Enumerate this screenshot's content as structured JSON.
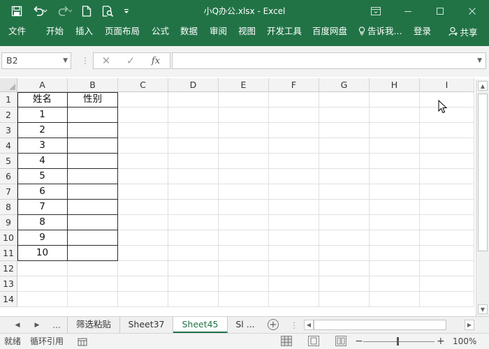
{
  "window": {
    "title": "小Q办公.xlsx  -  Excel"
  },
  "ribbon": {
    "tabs": [
      "文件",
      "开始",
      "插入",
      "页面布局",
      "公式",
      "数据",
      "审阅",
      "视图",
      "开发工具",
      "百度网盘",
      "告诉我...",
      "登录"
    ],
    "share_label": "共享"
  },
  "formula_bar": {
    "name_box": "B2",
    "fx_label": "fx",
    "content": ""
  },
  "sheet": {
    "columns": [
      "A",
      "B",
      "C",
      "D",
      "E",
      "F",
      "G",
      "H",
      "I"
    ],
    "rows": [
      "1",
      "2",
      "3",
      "4",
      "5",
      "6",
      "7",
      "8",
      "9",
      "10",
      "11",
      "12",
      "13",
      "14"
    ],
    "cells": {
      "A1": "姓名",
      "B1": "性别",
      "A2": "1",
      "A3": "2",
      "A4": "3",
      "A5": "4",
      "A6": "5",
      "A7": "6",
      "A8": "7",
      "A9": "8",
      "A10": "9",
      "A11": "10"
    }
  },
  "sheet_tabs": {
    "items": [
      "筛选粘贴",
      "Sheet37",
      "Sheet45",
      "Sl ..."
    ],
    "active": "Sheet45",
    "ellipsis": "..."
  },
  "status": {
    "ready": "就绪",
    "circular": "循环引用",
    "zoom": "100%"
  },
  "colors": {
    "brand": "#217346"
  }
}
